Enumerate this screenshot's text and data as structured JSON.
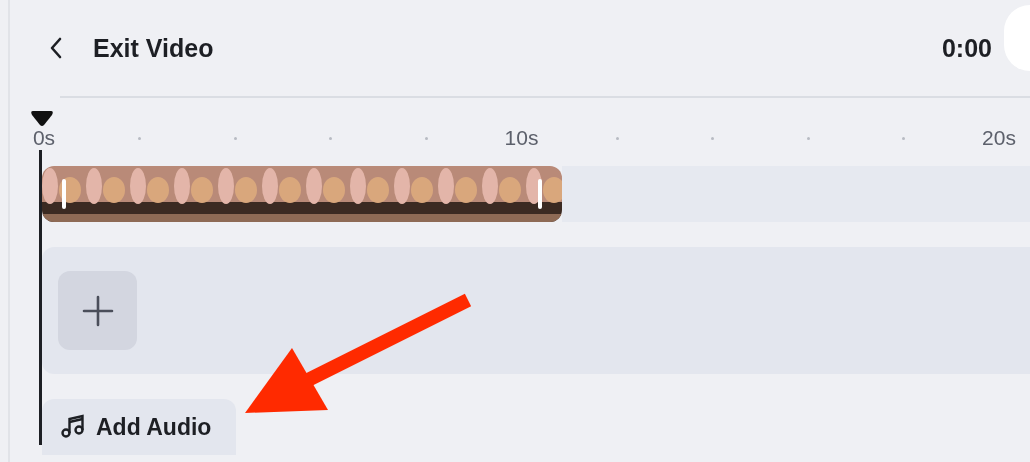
{
  "header": {
    "title": "Exit Video",
    "time": "0:00"
  },
  "ruler": {
    "labels": [
      "0s",
      "10s",
      "20s"
    ]
  },
  "audio": {
    "button": "Add Audio"
  }
}
